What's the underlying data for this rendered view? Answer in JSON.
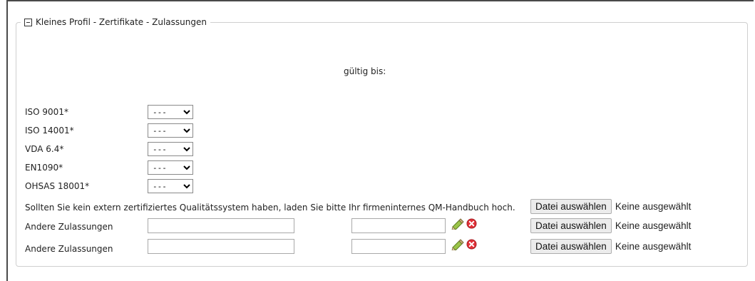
{
  "section": {
    "title": "Kleines Profil - Zertifikate - Zulassungen"
  },
  "valid_until_label": "gültig bis:",
  "certificates": [
    {
      "label": "ISO 9001*",
      "selected": "---"
    },
    {
      "label": "ISO 14001*",
      "selected": "---"
    },
    {
      "label": "VDA 6.4*",
      "selected": "---"
    },
    {
      "label": "EN1090*",
      "selected": "---"
    },
    {
      "label": "OHSAS 18001*",
      "selected": "---"
    }
  ],
  "qm_upload": {
    "text": "Sollten Sie kein extern zertifiziertes Qualitätssystem haben, laden Sie bitte Ihr firmeninternes QM-Handbuch hoch.",
    "button_label": "Datei auswählen",
    "status": "Keine ausgewählt"
  },
  "other_approvals": [
    {
      "label": "Andere Zulassungen",
      "name_value": "",
      "date_value": "",
      "button_label": "Datei auswählen",
      "status": "Keine ausgewählt"
    },
    {
      "label": "Andere Zulassungen",
      "name_value": "",
      "date_value": "",
      "button_label": "Datei auswählen",
      "status": "Keine ausgewählt"
    }
  ],
  "icons": {
    "calendar": "pencil-calendar-icon",
    "delete": "delete-circle-icon",
    "delete_color": "#e2323a",
    "calendar_color": "#8cb43c"
  }
}
